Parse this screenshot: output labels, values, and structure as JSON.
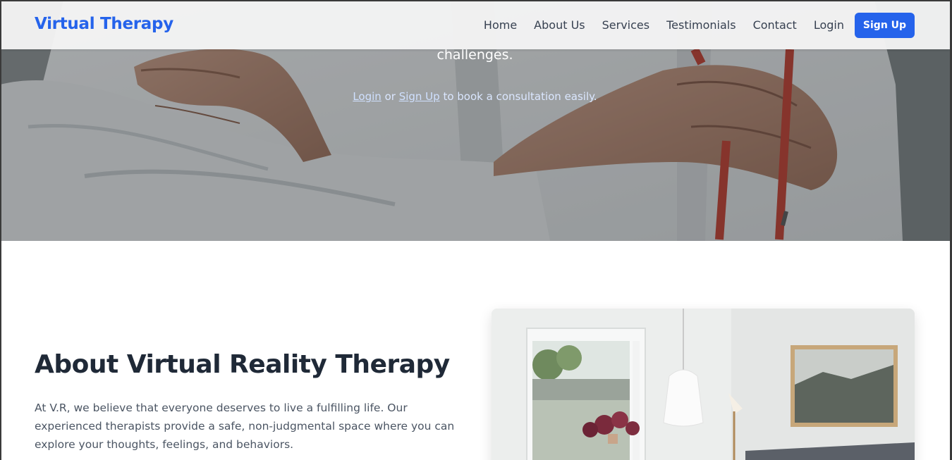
{
  "nav": {
    "brand": "Virtual Therapy",
    "links": [
      "Home",
      "About Us",
      "Services",
      "Testimonials",
      "Contact",
      "Login"
    ],
    "signup_label": "Sign Up"
  },
  "hero": {
    "subtitle_end": "challenges.",
    "cta_login": "Login",
    "cta_or": " or ",
    "cta_signup": "Sign Up",
    "cta_rest": " to book a consultation easily."
  },
  "about": {
    "title": "About Virtual Reality Therapy",
    "text": "At V.R, we believe that everyone deserves to live a fulfilling life. Our experienced therapists provide a safe, non-judgmental space where you can explore your thoughts, feelings, and behaviors."
  },
  "colors": {
    "accent": "#2563eb",
    "heading": "#1f2937",
    "body_text": "#4b5563"
  }
}
